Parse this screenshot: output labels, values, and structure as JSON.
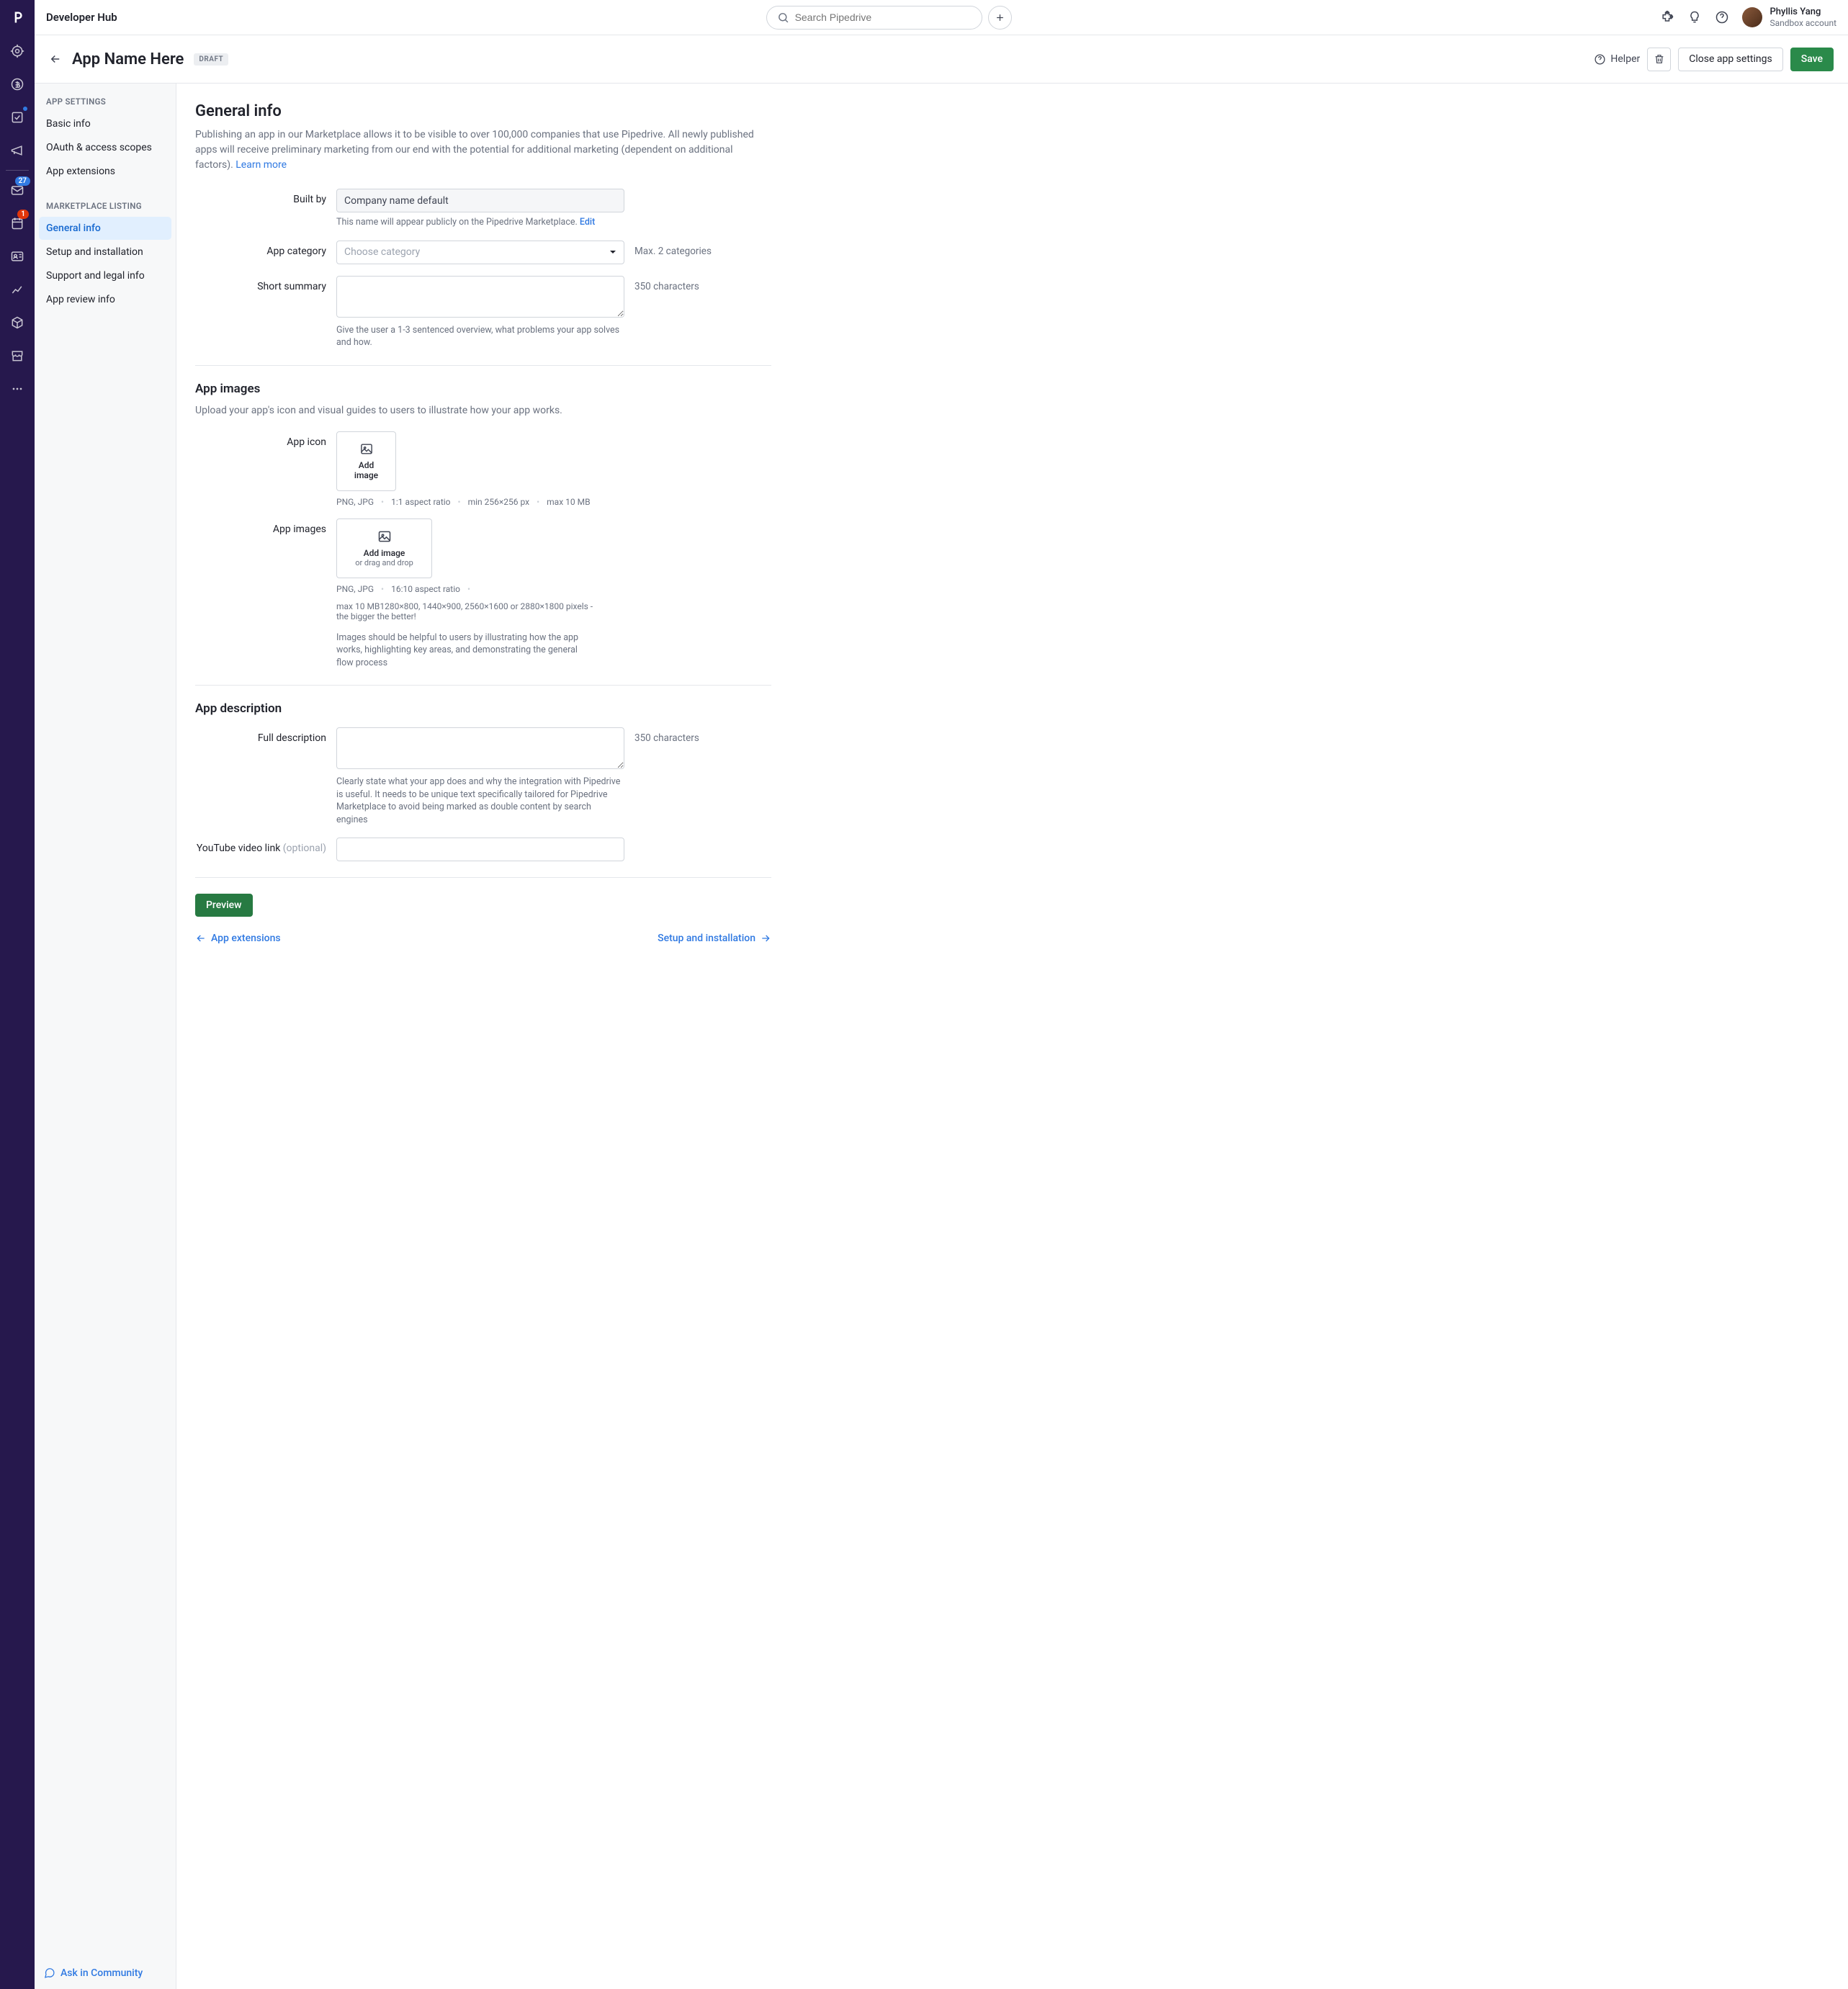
{
  "topbar": {
    "hub_title": "Developer Hub",
    "search_placeholder": "Search Pipedrive",
    "user_name": "Phyllis Yang",
    "user_sub": "Sandbox account"
  },
  "navrail_badges": {
    "mail": "27",
    "calendar": "1"
  },
  "pagehead": {
    "title": "App Name Here",
    "status": "DRAFT",
    "helper": "Helper",
    "close": "Close app settings",
    "save": "Save"
  },
  "sidebar": {
    "section1": "APP SETTINGS",
    "items1": [
      "Basic info",
      "OAuth & access scopes",
      "App extensions"
    ],
    "section2": "MARKETPLACE LISTING",
    "items2": [
      "General info",
      "Setup and installation",
      "Support and legal info",
      "App review info"
    ],
    "active": "General info"
  },
  "general": {
    "heading": "General info",
    "lead": "Publishing an app in our Marketplace allows it to be visible to over 100,000 companies that use Pipedrive. All newly published apps will receive preliminary marketing from our end with the potential for additional marketing (dependent on additional factors). ",
    "learn_more": "Learn more",
    "built_by_label": "Built by",
    "built_by_value": "Company name default",
    "built_by_hint": "This name will appear publicly on the Pipedrive Marketplace. ",
    "edit": "Edit",
    "category_label": "App category",
    "category_placeholder": "Choose category",
    "category_aside": "Max. 2 categories",
    "summary_label": "Short summary",
    "summary_aside": "350 characters",
    "summary_hint": "Give the user a 1-3 sentenced overview, what problems your app solves and how."
  },
  "images": {
    "heading": "App images",
    "lead": "Upload your app's icon and visual guides to users to illustrate how your app works.",
    "icon_label": "App icon",
    "add_image": "Add image",
    "drag_drop": "or drag and drop",
    "icon_meta": [
      "PNG, JPG",
      "1:1 aspect ratio",
      "min 256×256 px",
      "max 10 MB"
    ],
    "images_label": "App images",
    "images_meta_1": "PNG, JPG",
    "images_meta_2": "16:10 aspect ratio",
    "images_meta_3": "max 10 MB1280×800, 1440×900, 2560×1600 or 2880×1800 pixels - the bigger the better!",
    "images_hint": "Images should be helpful to users by illustrating how the app works, highlighting key areas, and demonstrating the general flow process"
  },
  "description": {
    "heading": "App description",
    "full_label": "Full description",
    "full_aside": "350 characters",
    "full_hint": "Clearly state what your app does and why the integration with Pipedrive is useful. It needs to be unique text specifically tailored for Pipedrive Marketplace to avoid being marked as double content by search engines",
    "youtube_label": "YouTube video link ",
    "youtube_optional": "(optional)"
  },
  "footer": {
    "preview": "Preview",
    "prev": "App extensions",
    "next": "Setup and installation",
    "community": "Ask in Community"
  }
}
